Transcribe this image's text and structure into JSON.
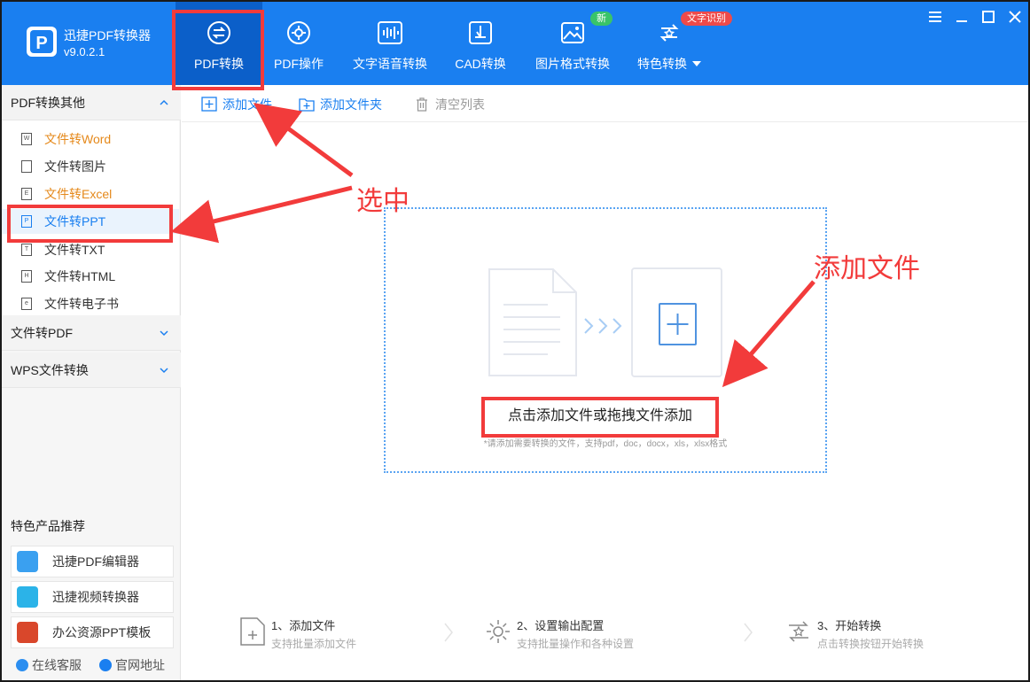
{
  "app": {
    "title": "迅捷PDF转换器",
    "version": "v9.0.2.1"
  },
  "nav": {
    "tabs": [
      {
        "label": "PDF转换",
        "icon": "pdf-convert-icon",
        "active": true
      },
      {
        "label": "PDF操作",
        "icon": "pdf-operation-icon"
      },
      {
        "label": "文字语音转换",
        "icon": "voice-wave-icon"
      },
      {
        "label": "CAD转换",
        "icon": "cad-icon"
      },
      {
        "label": "图片格式转换",
        "icon": "image-icon"
      },
      {
        "label": "特色转换",
        "icon": "special-convert-icon"
      }
    ],
    "badge_new": "新",
    "badge_ocr": "文字识别"
  },
  "window_controls": [
    "menu-icon",
    "minimize-icon",
    "maximize-icon",
    "close-icon"
  ],
  "sidebar": {
    "section1": {
      "title": "PDF转换其他",
      "items": [
        {
          "label": "文件转Word",
          "icon_text": "W"
        },
        {
          "label": "文件转图片",
          "icon_text": ""
        },
        {
          "label": "文件转Excel",
          "icon_text": "E"
        },
        {
          "label": "文件转PPT",
          "icon_text": "P"
        },
        {
          "label": "文件转TXT",
          "icon_text": "T"
        },
        {
          "label": "文件转HTML",
          "icon_text": "H"
        },
        {
          "label": "文件转电子书",
          "icon_text": "e"
        }
      ]
    },
    "section2": {
      "title": "文件转PDF"
    },
    "section3": {
      "title": "WPS文件转换"
    },
    "recommend": {
      "title": "特色产品推荐",
      "items": [
        {
          "label": "迅捷PDF编辑器",
          "color": "#3aa0f0"
        },
        {
          "label": "迅捷视频转换器",
          "color": "#2bb3e8"
        },
        {
          "label": "办公资源PPT模板",
          "color": "#d9472b"
        }
      ]
    },
    "footer": {
      "service": "在线客服",
      "website": "官网地址"
    }
  },
  "toolbar": {
    "add_file": "添加文件",
    "add_folder": "添加文件夹",
    "clear_list": "清空列表"
  },
  "dropzone": {
    "main_text": "点击添加文件或拖拽文件添加",
    "hint": "*请添加需要转换的文件，支持pdf，doc，docx，xls，xlsx格式"
  },
  "steps": [
    {
      "title": "1、添加文件",
      "sub": "支持批量添加文件"
    },
    {
      "title": "2、设置输出配置",
      "sub": "支持批量操作和各种设置"
    },
    {
      "title": "3、开始转换",
      "sub": "点击转换按钮开始转换"
    }
  ],
  "annotations": {
    "select_label": "选中",
    "add_file_label": "添加文件",
    "color": "#f23b3b"
  }
}
